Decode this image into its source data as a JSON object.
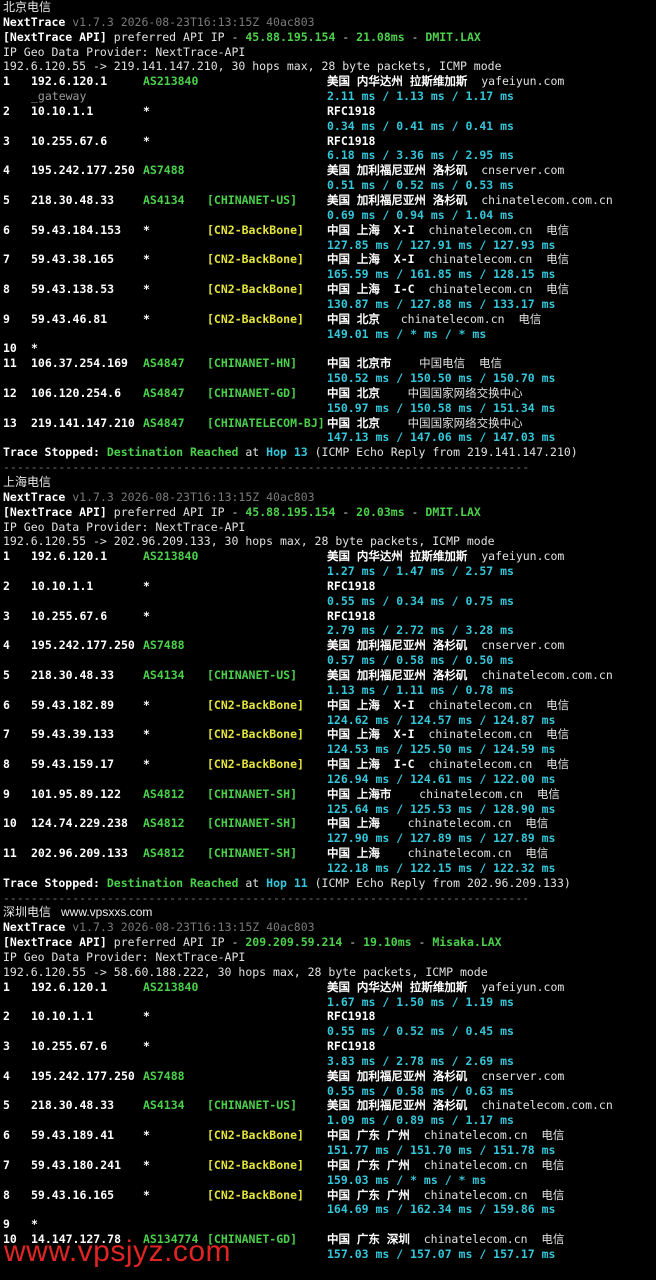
{
  "watermark": "www.vpsjyz.com",
  "blocks": [
    {
      "label": "北京电信",
      "site": "",
      "version_line": "v1.7.3 2026-08-23T16:13:15Z 40ac803",
      "api_ip": "45.88.195.154",
      "api_ms": "21.08ms",
      "api_node": "DMIT.LAX",
      "geo": "IP Geo Data Provider: NextTrace-API",
      "target": "192.6.120.55 -> 219.141.147.210, 30 hops max, 28 byte packets, ICMP mode",
      "hops": [
        {
          "n": "1",
          "ip": "192.6.120.1",
          "as": "AS213840",
          "tag": "",
          "geo": "美国 内华达州 拉斯维加斯",
          "geo_extra": "yafeiyun.com",
          "extra": "_gateway",
          "rtt": "2.11 ms / 1.13 ms / 1.17 ms"
        },
        {
          "n": "2",
          "ip": "10.10.1.1",
          "as": "*",
          "tag": "",
          "geo": "RFC1918",
          "geo_extra": "",
          "extra": "",
          "rtt": "0.34 ms / 0.41 ms / 0.41 ms"
        },
        {
          "n": "3",
          "ip": "10.255.67.6",
          "as": "*",
          "tag": "",
          "geo": "RFC1918",
          "geo_extra": "",
          "extra": "",
          "rtt": "6.18 ms / 3.36 ms / 2.95 ms"
        },
        {
          "n": "4",
          "ip": "195.242.177.250",
          "as": "AS7488",
          "tag": "",
          "geo": "美国 加利福尼亚州 洛杉矶",
          "geo_extra": "cnserver.com",
          "extra": "",
          "rtt": "0.51 ms / 0.52 ms / 0.53 ms"
        },
        {
          "n": "5",
          "ip": "218.30.48.33",
          "as": "AS4134",
          "tag": "[CHINANET-US]",
          "geo": "美国 加利福尼亚州 洛杉矶",
          "geo_extra": "chinatelecom.com.cn",
          "extra": "",
          "rtt": "0.69 ms / 0.94 ms / 1.04 ms"
        },
        {
          "n": "6",
          "ip": "59.43.184.153",
          "as": "*",
          "tag": "[CN2-BackBone]",
          "geo": "中国 上海  X-I",
          "geo_extra": "chinatelecom.cn  电信",
          "extra": "",
          "rtt": "127.85 ms / 127.91 ms / 127.93 ms"
        },
        {
          "n": "7",
          "ip": "59.43.38.165",
          "as": "*",
          "tag": "[CN2-BackBone]",
          "geo": "中国 上海  X-I",
          "geo_extra": "chinatelecom.cn  电信",
          "extra": "",
          "rtt": "165.59 ms / 161.85 ms / 128.15 ms"
        },
        {
          "n": "8",
          "ip": "59.43.138.53",
          "as": "*",
          "tag": "[CN2-BackBone]",
          "geo": "中国 上海  I-C",
          "geo_extra": "chinatelecom.cn  电信",
          "extra": "",
          "rtt": "130.87 ms / 127.88 ms / 133.17 ms"
        },
        {
          "n": "9",
          "ip": "59.43.46.81",
          "as": "*",
          "tag": "[CN2-BackBone]",
          "geo": "中国 北京",
          "geo_extra": " chinatelecom.cn  电信",
          "extra": "",
          "rtt": "149.01 ms / * ms / * ms"
        },
        {
          "n": "10",
          "ip": "*",
          "as": "",
          "tag": "",
          "geo": "",
          "geo_extra": "",
          "extra": "",
          "rtt": ""
        },
        {
          "n": "11",
          "ip": "106.37.254.169",
          "as": "AS4847",
          "tag": "[CHINANET-HN]",
          "geo": "中国 北京市",
          "geo_extra": "  中国电信  电信",
          "extra": "",
          "rtt": "150.52 ms / 150.50 ms / 150.70 ms"
        },
        {
          "n": "12",
          "ip": "106.120.254.6",
          "as": "AS4847",
          "tag": "[CHINANET-GD]",
          "geo": "中国 北京",
          "geo_extra": "  中国国家网络交换中心",
          "extra": "",
          "rtt": "150.97 ms / 150.58 ms / 151.34 ms"
        },
        {
          "n": "13",
          "ip": "219.141.147.210",
          "as": "AS4847",
          "tag": "[CHINATELECOM-BJ]",
          "geo": "中国 北京",
          "geo_extra": "  中国国家网络交换中心",
          "extra": "",
          "rtt": "147.13 ms / 147.06 ms / 147.03 ms"
        }
      ],
      "stop": {
        "hop": "Hop 13",
        "tail": "(ICMP Echo Reply from 219.141.147.210)"
      }
    },
    {
      "label": "上海电信",
      "site": "",
      "version_line": "v1.7.3 2026-08-23T16:13:15Z 40ac803",
      "api_ip": "45.88.195.154",
      "api_ms": "20.03ms",
      "api_node": "DMIT.LAX",
      "geo": "IP Geo Data Provider: NextTrace-API",
      "target": "192.6.120.55 -> 202.96.209.133, 30 hops max, 28 byte packets, ICMP mode",
      "hops": [
        {
          "n": "1",
          "ip": "192.6.120.1",
          "as": "AS213840",
          "tag": "",
          "geo": "美国 内华达州 拉斯维加斯",
          "geo_extra": "yafeiyun.com",
          "extra": "",
          "rtt": "1.27 ms / 1.47 ms / 2.57 ms"
        },
        {
          "n": "2",
          "ip": "10.10.1.1",
          "as": "*",
          "tag": "",
          "geo": "RFC1918",
          "geo_extra": "",
          "extra": "",
          "rtt": "0.55 ms / 0.34 ms / 0.75 ms"
        },
        {
          "n": "3",
          "ip": "10.255.67.6",
          "as": "*",
          "tag": "",
          "geo": "RFC1918",
          "geo_extra": "",
          "extra": "",
          "rtt": "2.79 ms / 2.72 ms / 3.28 ms"
        },
        {
          "n": "4",
          "ip": "195.242.177.250",
          "as": "AS7488",
          "tag": "",
          "geo": "美国 加利福尼亚州 洛杉矶",
          "geo_extra": "cnserver.com",
          "extra": "",
          "rtt": "0.57 ms / 0.58 ms / 0.50 ms"
        },
        {
          "n": "5",
          "ip": "218.30.48.33",
          "as": "AS4134",
          "tag": "[CHINANET-US]",
          "geo": "美国 加利福尼亚州 洛杉矶",
          "geo_extra": "chinatelecom.com.cn",
          "extra": "",
          "rtt": "1.13 ms / 1.11 ms / 0.78 ms"
        },
        {
          "n": "6",
          "ip": "59.43.182.89",
          "as": "*",
          "tag": "[CN2-BackBone]",
          "geo": "中国 上海  X-I",
          "geo_extra": "chinatelecom.cn  电信",
          "extra": "",
          "rtt": "124.62 ms / 124.57 ms / 124.87 ms"
        },
        {
          "n": "7",
          "ip": "59.43.39.133",
          "as": "*",
          "tag": "[CN2-BackBone]",
          "geo": "中国 上海  X-I",
          "geo_extra": "chinatelecom.cn  电信",
          "extra": "",
          "rtt": "124.53 ms / 125.50 ms / 124.59 ms"
        },
        {
          "n": "8",
          "ip": "59.43.159.17",
          "as": "*",
          "tag": "[CN2-BackBone]",
          "geo": "中国 上海  I-C",
          "geo_extra": "chinatelecom.cn  电信",
          "extra": "",
          "rtt": "126.94 ms / 124.61 ms / 122.00 ms"
        },
        {
          "n": "9",
          "ip": "101.95.89.122",
          "as": "AS4812",
          "tag": "[CHINANET-SH]",
          "geo": "中国 上海市",
          "geo_extra": "  chinatelecom.cn  电信",
          "extra": "",
          "rtt": "125.64 ms / 125.53 ms / 128.90 ms"
        },
        {
          "n": "10",
          "ip": "124.74.229.238",
          "as": "AS4812",
          "tag": "[CHINANET-SH]",
          "geo": "中国 上海",
          "geo_extra": "  chinatelecom.cn  电信",
          "extra": "",
          "rtt": "127.90 ms / 127.89 ms / 127.89 ms"
        },
        {
          "n": "11",
          "ip": "202.96.209.133",
          "as": "AS4812",
          "tag": "[CHINANET-SH]",
          "geo": "中国 上海",
          "geo_extra": "  chinatelecom.cn  电信",
          "extra": "",
          "rtt": "122.18 ms / 122.15 ms / 122.32 ms"
        }
      ],
      "stop": {
        "hop": "Hop 11",
        "tail": "(ICMP Echo Reply from 202.96.209.133)"
      }
    },
    {
      "label": "深圳电信",
      "site": "www.vpsxxs.com",
      "version_line": "v1.7.3 2026-08-23T16:13:15Z 40ac803",
      "api_ip": "209.209.59.214",
      "api_ms": "19.10ms",
      "api_node": "Misaka.LAX",
      "geo": "IP Geo Data Provider: NextTrace-API",
      "target": "192.6.120.55 -> 58.60.188.222, 30 hops max, 28 byte packets, ICMP mode",
      "hops": [
        {
          "n": "1",
          "ip": "192.6.120.1",
          "as": "AS213840",
          "tag": "",
          "geo": "美国 内华达州 拉斯维加斯",
          "geo_extra": "yafeiyun.com",
          "extra": "",
          "rtt": "1.67 ms / 1.50 ms / 1.19 ms"
        },
        {
          "n": "2",
          "ip": "10.10.1.1",
          "as": "*",
          "tag": "",
          "geo": "RFC1918",
          "geo_extra": "",
          "extra": "",
          "rtt": "0.55 ms / 0.52 ms / 0.45 ms"
        },
        {
          "n": "3",
          "ip": "10.255.67.6",
          "as": "*",
          "tag": "",
          "geo": "RFC1918",
          "geo_extra": "",
          "extra": "",
          "rtt": "3.83 ms / 2.78 ms / 2.69 ms"
        },
        {
          "n": "4",
          "ip": "195.242.177.250",
          "as": "AS7488",
          "tag": "",
          "geo": "美国 加利福尼亚州 洛杉矶",
          "geo_extra": "cnserver.com",
          "extra": "",
          "rtt": "0.55 ms / 0.58 ms / 0.63 ms"
        },
        {
          "n": "5",
          "ip": "218.30.48.33",
          "as": "AS4134",
          "tag": "[CHINANET-US]",
          "geo": "美国 加利福尼亚州 洛杉矶",
          "geo_extra": "chinatelecom.com.cn",
          "extra": "",
          "rtt": "1.09 ms / 0.89 ms / 1.17 ms"
        },
        {
          "n": "6",
          "ip": "59.43.189.41",
          "as": "*",
          "tag": "[CN2-BackBone]",
          "geo": "中国 广东 广州",
          "geo_extra": "chinatelecom.cn  电信",
          "extra": "",
          "rtt": "151.77 ms / 151.70 ms / 151.78 ms"
        },
        {
          "n": "7",
          "ip": "59.43.180.241",
          "as": "*",
          "tag": "[CN2-BackBone]",
          "geo": "中国 广东 广州",
          "geo_extra": "chinatelecom.cn  电信",
          "extra": "",
          "rtt": "159.03 ms / * ms / * ms"
        },
        {
          "n": "8",
          "ip": "59.43.16.165",
          "as": "*",
          "tag": "[CN2-BackBone]",
          "geo": "中国 广东 广州",
          "geo_extra": "chinatelecom.cn  电信",
          "extra": "",
          "rtt": "164.69 ms / 162.34 ms / 159.86 ms"
        },
        {
          "n": "9",
          "ip": "*",
          "as": "",
          "tag": "",
          "geo": "",
          "geo_extra": "",
          "extra": "",
          "rtt": ""
        },
        {
          "n": "10",
          "ip": "14.147.127.78",
          "as": "AS134774",
          "tag": "[CHINANET-GD]",
          "geo": "中国 广东 深圳",
          "geo_extra": "chinatelecom.cn  电信",
          "extra": "",
          "rtt": "157.03 ms / 157.07 ms / 157.17 ms"
        }
      ],
      "stop": null
    }
  ],
  "static": {
    "app": "NextTrace",
    "api_prefix": "[NextTrace API]",
    "api_mid": "preferred API IP -",
    "dash": "-",
    "stopped": "Trace Stopped:",
    "reached": "Destination Reached",
    "at": "at",
    "separator": "----------------------------------------------------------------------------"
  }
}
